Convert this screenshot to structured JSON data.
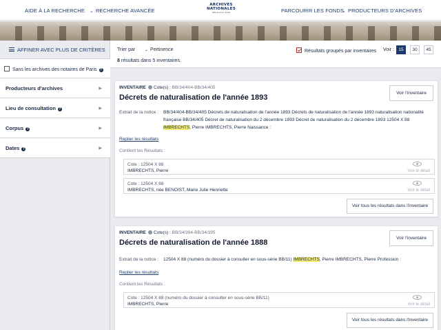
{
  "header": {
    "nav_left_1": "AIDE À LA RECHERCHE",
    "nav_left_2": "RECHERCHE AVANCÉE",
    "logo_line_1": "ARCHIVES",
    "logo_line_2": "NATIONALES",
    "logo_tagline": "Salle de lecture virtuelle",
    "nav_right_1": "PARCOURIR LES FONDS",
    "nav_right_2": "PRODUCTEURS D'ARCHIVES"
  },
  "sidebar": {
    "refine_label": "AFFINER AVEC PLUS DE CRITÈRES",
    "notaires_label": "Sans les archives des notaires de Paris",
    "facets": [
      {
        "label": "Producteurs d'archives",
        "help": false
      },
      {
        "label": "Lieu de consultation",
        "help": true
      },
      {
        "label": "Corpus",
        "help": true
      },
      {
        "label": "Dates",
        "help": true
      }
    ]
  },
  "toolbar": {
    "sort_label": "Trier par",
    "sort_value": "Pertinence",
    "count_number": "8",
    "count_text": "résultats dans 5 inventaires.",
    "grouped_label": "Résultats groupés par inventaires",
    "voir_label": "Voir :",
    "page_sizes": [
      "15",
      "30",
      "45"
    ],
    "active_page_size": "15"
  },
  "results": [
    {
      "type_label": "INVENTAIRE",
      "cote_label": "Cote(s) :",
      "cote_value": "BB/34/404-BB/34/405",
      "title": "Décrets de naturalisation de l'année 1893",
      "btn_inventaire": "Voir l'inventaire",
      "extract_label": "Extrait de la notice :",
      "extract_line_1": "BB/34/404-BB/34/405 Décrets de naturalisation de l'année 1893 Décrets de naturalisation de l'année 1893 naturalisation nationalité",
      "extract_line_2": "française BB/34/405 Décret de naturalisation du 2 décembre 1893 Décret de naturalisation du 2 décembre 1893 12504 X 88",
      "extract_highlight": "IMBRECHTS",
      "extract_tail": ", Pierre IMBRECHTS, Pierre Naissance :",
      "replier": "Replier les résultats",
      "contient": "Contient les Résultats :",
      "items": [
        {
          "cote": "Cote : 12504 X 88",
          "name_before": "IMBRECHTS, Pierre",
          "name_hl": "",
          "name_after": "",
          "detail": "Voir le détail"
        },
        {
          "cote": "Cote : 12504 X 88",
          "name_before": "IMBRECHTS, née BENOIST, Marie Julie Henriette",
          "name_hl": "",
          "name_after": "",
          "detail": "Voir le détail"
        }
      ],
      "btn_all": "Voir tous les résultats dans l'inventaire"
    },
    {
      "type_label": "INVENTAIRE",
      "cote_label": "Cote(s) :",
      "cote_value": "BB/34/394-BB/34/395",
      "title": "Décrets de naturalisation de l'année 1888",
      "btn_inventaire": "Voir l'inventaire",
      "extract_label": "Extrait de la notice :",
      "extract_line_1a": "12504 X 88 (numéro du dossier à consulter en sous-série BB/11)",
      "extract_highlight": "IMBRECHTS",
      "extract_line_1b": ", Pierre IMBRECHTS, Pierre Profession :",
      "replier": "Replier les résultats",
      "contient": "Contient les Résultats :",
      "items": [
        {
          "cote": "Cote : 12504 X 88 (numéro du dossier à consulter en sous-série BB/11)",
          "name_before": "IMBRECHTS, Pierre",
          "detail": "Voir le détail"
        }
      ],
      "btn_all": "Voir tous les résultats dans l'inventaire"
    }
  ],
  "icons": [
    "chevron-down-icon",
    "hamburger-icon",
    "help-icon",
    "caret-right-icon",
    "info-icon",
    "eye-icon",
    "checkbox-icon"
  ],
  "colors": {
    "brand": "#1d3a6e",
    "highlight": "#f4ec72",
    "background": "#e9ebef"
  }
}
